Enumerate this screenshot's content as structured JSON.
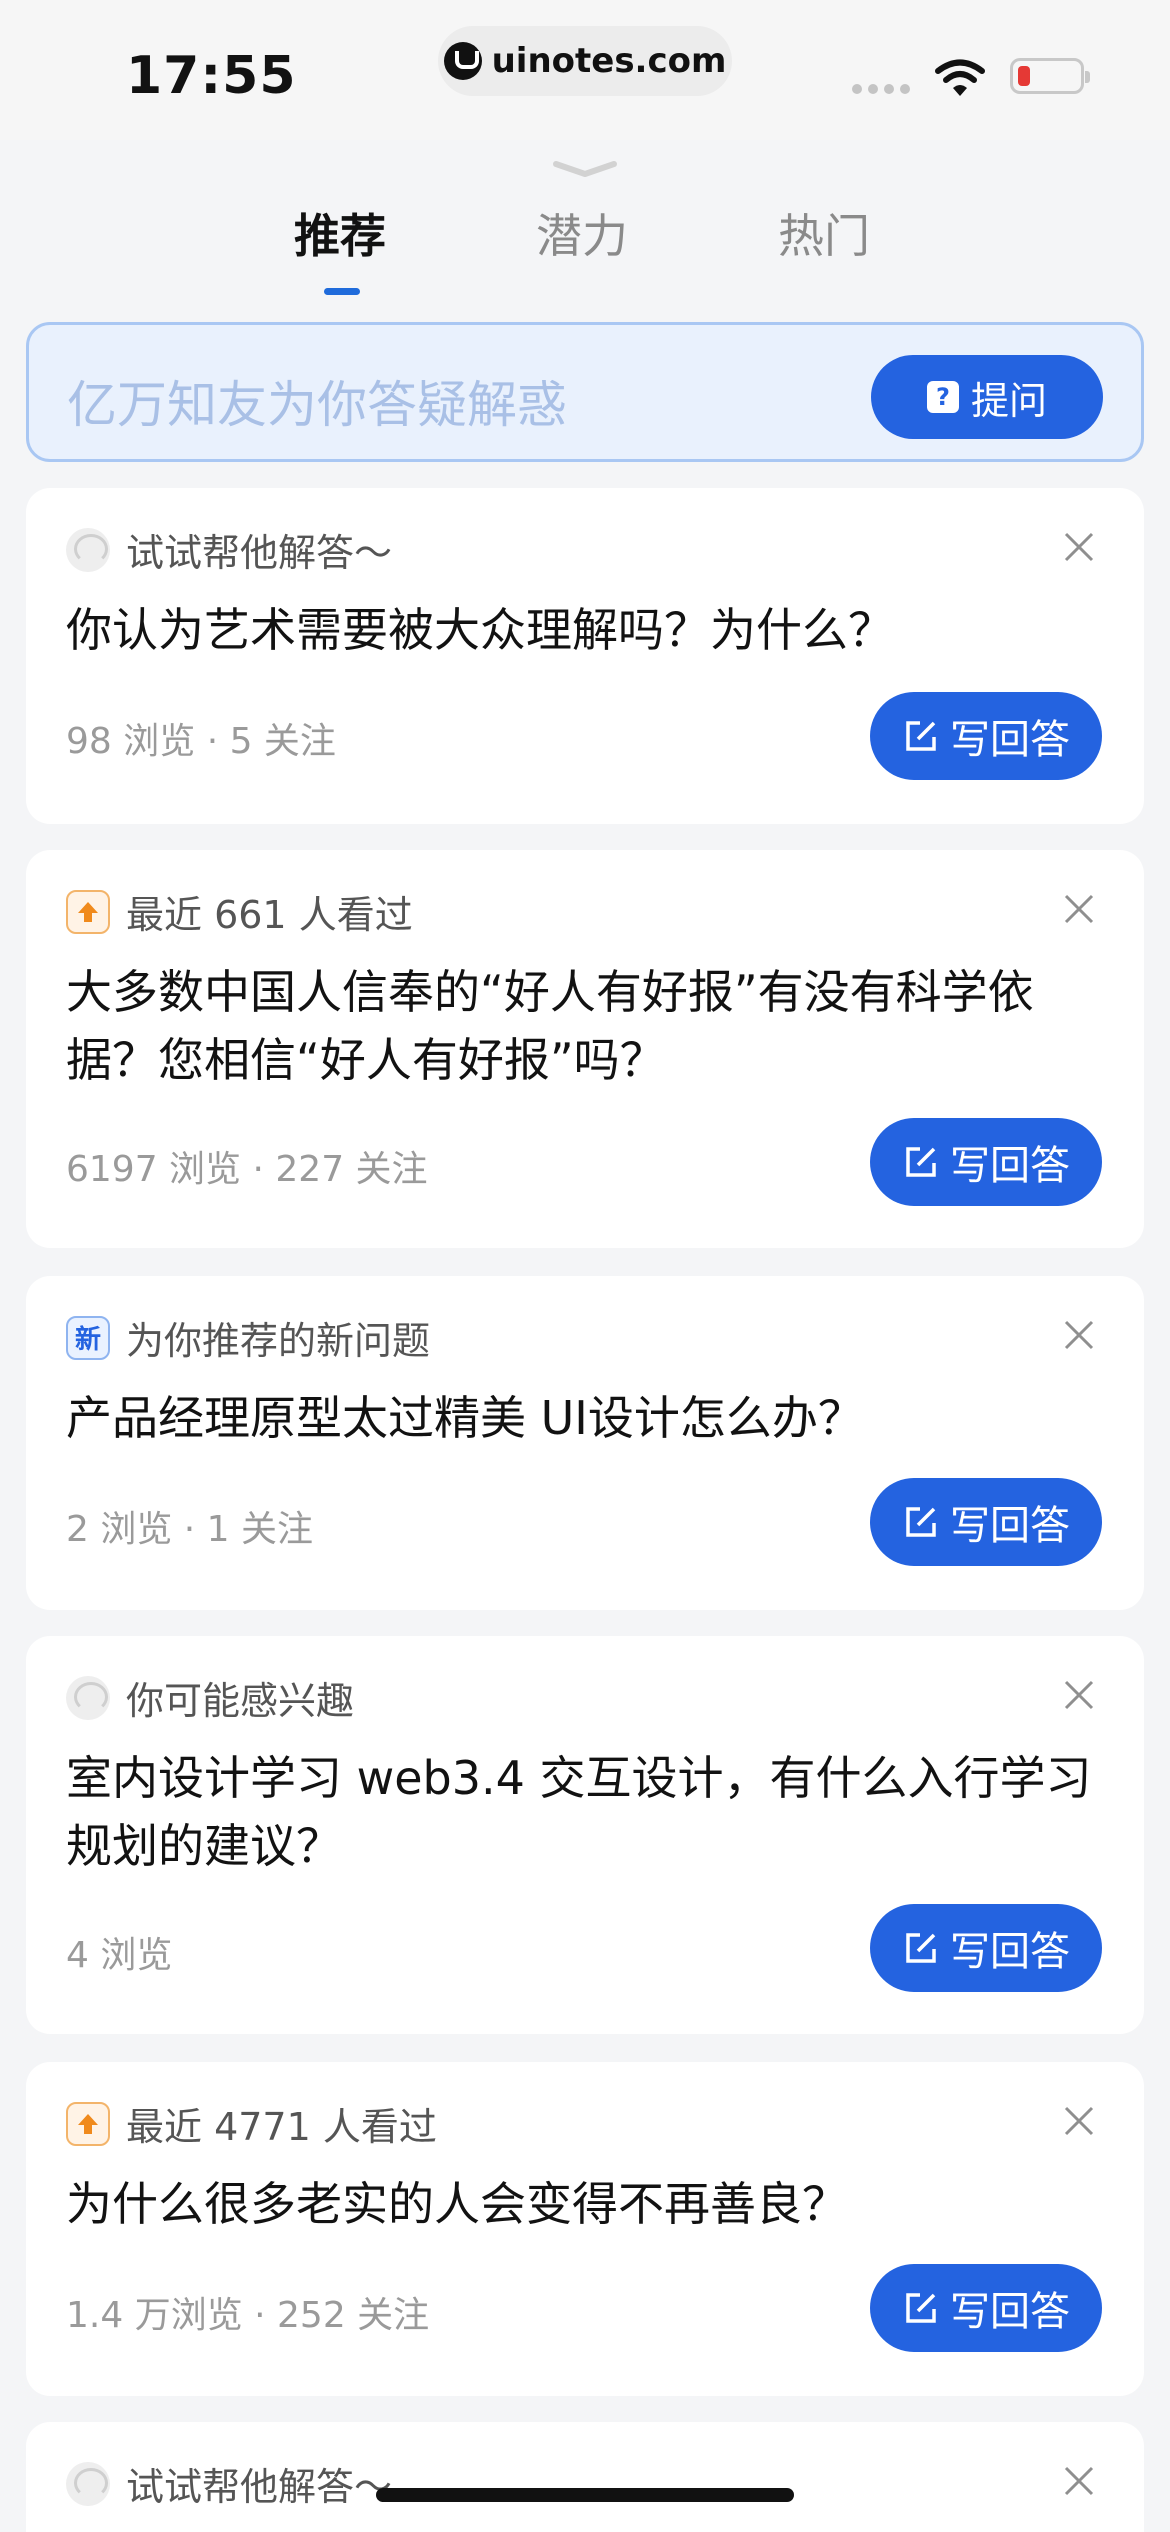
{
  "status_bar": {
    "time": "17:55",
    "url": "uinotes.com"
  },
  "tabs": [
    {
      "label": "推荐",
      "active": true
    },
    {
      "label": "潜力",
      "active": false
    },
    {
      "label": "热门",
      "active": false
    }
  ],
  "search": {
    "placeholder": "亿万知友为你答疑解惑",
    "ask_label": "提问"
  },
  "answer_label": "写回答",
  "cards": [
    {
      "icon": "avatar-icon",
      "head": "试试帮他解答～",
      "title": "你认为艺术需要被大众理解吗？为什么？",
      "meta": "98 浏览 · 5 关注"
    },
    {
      "icon": "trending-up-icon",
      "head": "最近 661 人看过",
      "title": "大多数中国人信奉的“好人有好报”有没有科学依据？您相信“好人有好报”吗？",
      "meta": "6197 浏览 · 227 关注"
    },
    {
      "icon": "new-badge-icon",
      "icon_text": "新",
      "head": "为你推荐的新问题",
      "title": "产品经理原型太过精美 UI设计怎么办？",
      "meta": "2 浏览 · 1 关注"
    },
    {
      "icon": "avatar-icon",
      "head": "你可能感兴趣",
      "title": "室内设计学习 web3.4 交互设计，有什么入行学习规划的建议？",
      "meta": "4 浏览"
    },
    {
      "icon": "trending-up-icon",
      "head": "最近 4771 人看过",
      "title": "为什么很多老实的人会变得不再善良？",
      "meta": "1.4 万浏览 · 252 关注"
    },
    {
      "icon": "avatar-icon",
      "head": "试试帮他解答～",
      "title": "",
      "meta": ""
    }
  ],
  "colors": {
    "accent": "#2463e0",
    "background": "#f4f5f7"
  }
}
